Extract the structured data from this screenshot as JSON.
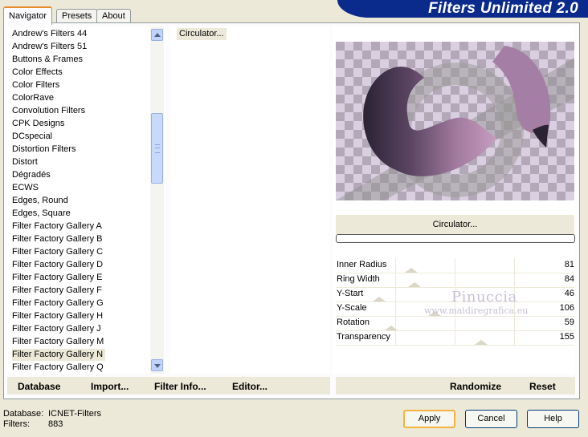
{
  "app": {
    "title": "Filters Unlimited 2.0"
  },
  "tabs": [
    {
      "label": "Navigator",
      "active": true
    },
    {
      "label": "Presets",
      "active": false
    },
    {
      "label": "About",
      "active": false
    }
  ],
  "categories": [
    "Andrew's Filters 44",
    "Andrew's Filters 51",
    "Buttons & Frames",
    "Color Effects",
    "Color Filters",
    "ColorRave",
    "Convolution Filters",
    "CPK Designs",
    "DCspecial",
    "Distortion Filters",
    "Distort",
    "Dégradés",
    "ECWS",
    "Edges, Round",
    "Edges, Square",
    "Filter Factory Gallery A",
    "Filter Factory Gallery B",
    "Filter Factory Gallery C",
    "Filter Factory Gallery D",
    "Filter Factory Gallery E",
    "Filter Factory Gallery F",
    "Filter Factory Gallery G",
    "Filter Factory Gallery H",
    "Filter Factory Gallery J",
    "Filter Factory Gallery M",
    "Filter Factory Gallery N",
    "Filter Factory Gallery Q"
  ],
  "selected_category": "Filter Factory Gallery N",
  "filters": [
    "Circulator..."
  ],
  "filter_name": "Circulator...",
  "left_actions": {
    "database": "Database",
    "import": "Import...",
    "filter_info": "Filter Info...",
    "editor": "Editor..."
  },
  "right_actions": {
    "randomize": "Randomize",
    "reset": "Reset"
  },
  "params": [
    {
      "label": "Inner Radius",
      "value": "81",
      "level": 81
    },
    {
      "label": "Ring Width",
      "value": "84",
      "level": 84
    },
    {
      "label": "Y-Start",
      "value": "46",
      "level": 46
    },
    {
      "label": "Y-Scale",
      "value": "106",
      "level": 106
    },
    {
      "label": "Rotation",
      "value": "59",
      "level": 59
    },
    {
      "label": "Transparency",
      "value": "155",
      "level": 155
    }
  ],
  "watermark": {
    "line1": "Pinuccia",
    "line2": "www.maidiregrafica.eu"
  },
  "status": {
    "database_label": "Database:",
    "database_value": "ICNET-Filters",
    "filters_label": "Filters:",
    "filters_value": "883"
  },
  "buttons": {
    "apply": "Apply",
    "cancel": "Cancel",
    "help": "Help"
  },
  "colors": {
    "banner": "#0a2a8c",
    "preview_purple": "#a77aa3",
    "preview_dark": "#2e2436"
  }
}
